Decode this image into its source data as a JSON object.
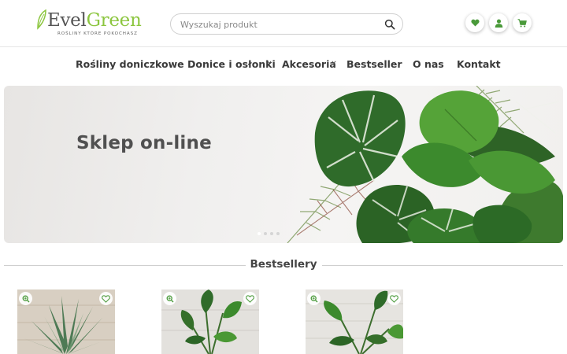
{
  "header": {
    "logo": {
      "word_dark": "Evel",
      "word_green": "Green",
      "tagline": "ROŚLINY KTÓRE POKOCHASZ"
    },
    "search": {
      "placeholder": "Wyszukaj produkt",
      "icon": "search-icon"
    },
    "icons": [
      "heart-icon",
      "user-icon",
      "cart-icon"
    ]
  },
  "nav": {
    "items": [
      {
        "label": "Rośliny doniczkowe",
        "has_dropdown": false
      },
      {
        "label": "Donice i osłonki",
        "has_dropdown": true
      },
      {
        "label": "Akcesoria",
        "has_dropdown": true
      },
      {
        "label": "Bestseller",
        "has_dropdown": false
      },
      {
        "label": "O nas",
        "has_dropdown": false
      },
      {
        "label": "Kontakt",
        "has_dropdown": false
      }
    ]
  },
  "hero": {
    "title": "Sklep on-line",
    "slide_count": 4,
    "active_slide": 1
  },
  "bestsellers": {
    "title": "Bestsellery",
    "products": [
      {
        "plant": "aloe",
        "icons": [
          "zoom-icon",
          "heart-icon"
        ]
      },
      {
        "plant": "strelitzia",
        "icons": [
          "zoom-icon",
          "heart-icon"
        ]
      },
      {
        "plant": "strelitzia",
        "icons": [
          "zoom-icon",
          "heart-icon"
        ]
      }
    ]
  },
  "colors": {
    "brand_green": "#8cc63f",
    "leaf_dark": "#2f6b2a",
    "text_dark": "#3a3a3a"
  }
}
